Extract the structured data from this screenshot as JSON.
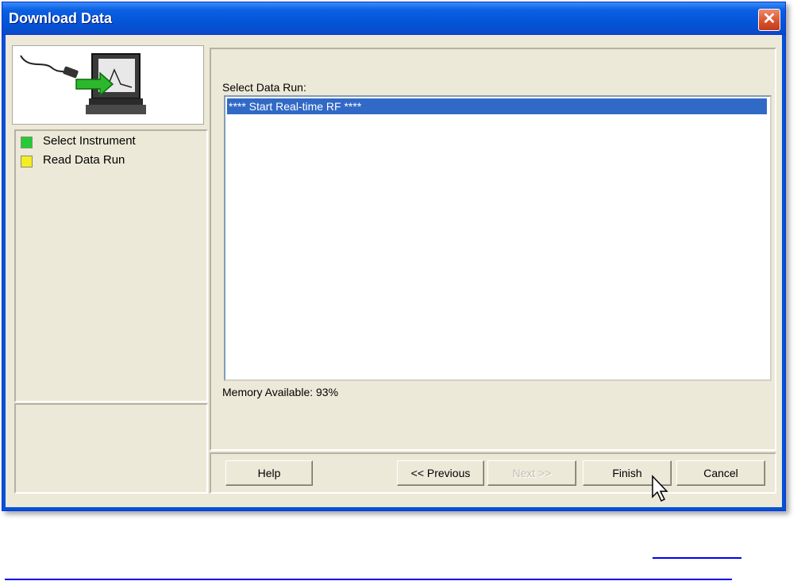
{
  "window": {
    "title": "Download Data",
    "close_glyph": "✕"
  },
  "wizard": {
    "illustration_icon": "instrument-to-computer-icon",
    "steps": [
      {
        "label": "Select Instrument",
        "color": "#22cc33",
        "state": "complete"
      },
      {
        "label": "Read Data Run",
        "color": "#f5ee22",
        "state": "current"
      }
    ]
  },
  "data_run": {
    "label": "Select Data Run:",
    "items": [
      "**** Start Real-time RF ****"
    ],
    "selected_index": 0
  },
  "memory": {
    "text": "Memory Available: 93%"
  },
  "buttons": {
    "help": "Help",
    "previous": "<< Previous",
    "next": "Next >>",
    "finish": "Finish",
    "cancel": "Cancel"
  },
  "colors": {
    "title_bar": "#0453d6",
    "selection": "#3169c6",
    "window_bg": "#ece9d8"
  }
}
